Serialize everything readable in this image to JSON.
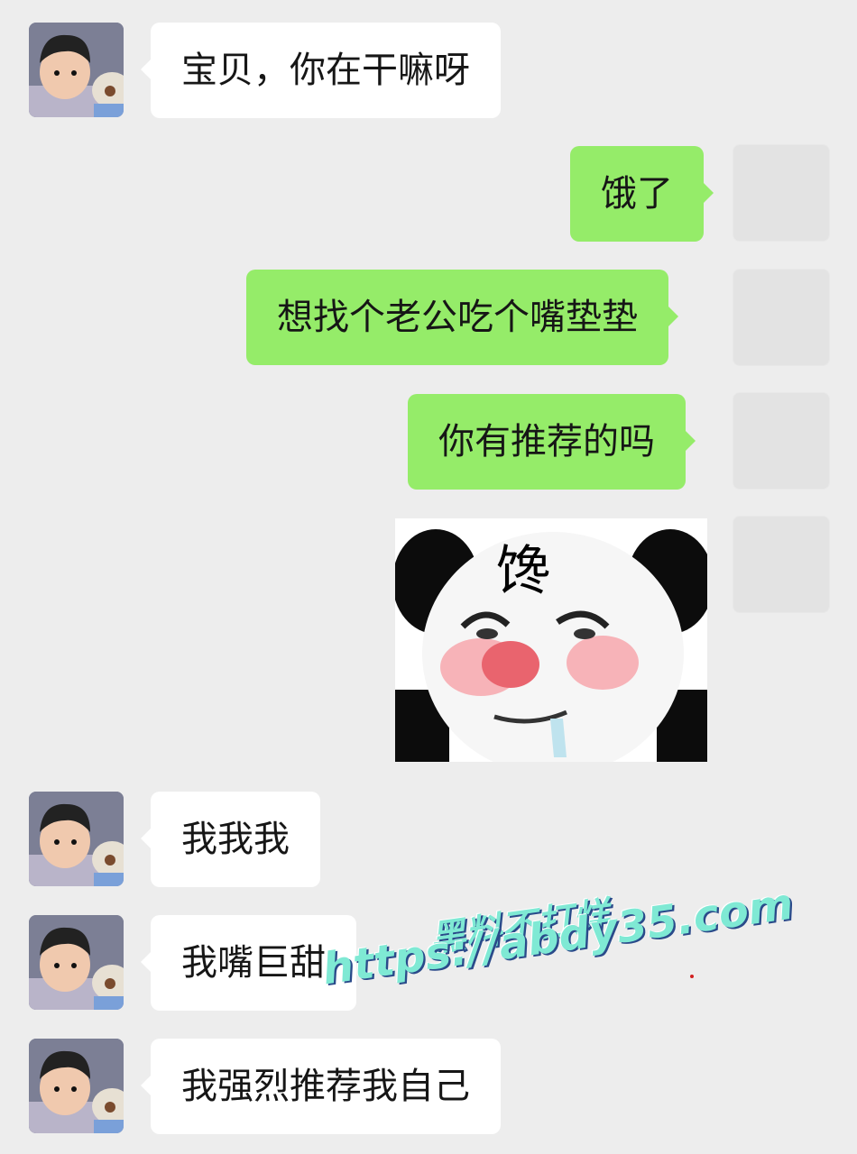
{
  "messages": [
    {
      "side": "left",
      "text": "宝贝，你在干嘛呀"
    },
    {
      "side": "right",
      "text": "饿了"
    },
    {
      "side": "right",
      "text": "想找个老公吃个嘴垫垫"
    },
    {
      "side": "right",
      "text": "你有推荐的吗"
    },
    {
      "side": "right",
      "type": "sticker",
      "sticker_text": "馋"
    },
    {
      "side": "left",
      "text": "我我我"
    },
    {
      "side": "left",
      "text": "我嘴巨甜"
    },
    {
      "side": "left",
      "text": "我强烈推荐我自己"
    }
  ],
  "watermark": {
    "title": "黑料不打烊",
    "url": "https://abdy35.com"
  },
  "colors": {
    "background": "#ededed",
    "incoming_bubble": "#ffffff",
    "outgoing_bubble": "#95ec69",
    "watermark": "#7fe9d4"
  }
}
